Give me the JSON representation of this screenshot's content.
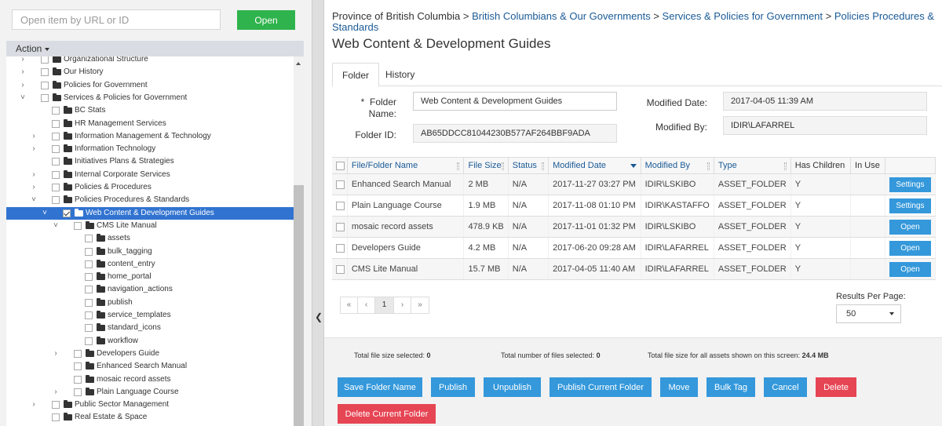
{
  "left": {
    "url_placeholder": "Open item by URL or ID",
    "open_label": "Open",
    "action_label": "Action"
  },
  "tree": [
    {
      "label": "Organizational Structure",
      "level": 0,
      "expander": "right",
      "checked": false,
      "selected": false
    },
    {
      "label": "Our History",
      "level": 0,
      "expander": "right",
      "checked": false,
      "selected": false
    },
    {
      "label": "Policies for Government",
      "level": 0,
      "expander": "right",
      "checked": false,
      "selected": false
    },
    {
      "label": "Services & Policies for Government",
      "level": 0,
      "expander": "down",
      "checked": false,
      "selected": false
    },
    {
      "label": "BC Stats",
      "level": 1,
      "expander": "none",
      "checked": false,
      "selected": false
    },
    {
      "label": "HR Management Services",
      "level": 1,
      "expander": "none",
      "checked": false,
      "selected": false
    },
    {
      "label": "Information Management & Technology",
      "level": 1,
      "expander": "right",
      "checked": false,
      "selected": false
    },
    {
      "label": "Information Technology",
      "level": 1,
      "expander": "right",
      "checked": false,
      "selected": false
    },
    {
      "label": "Initiatives Plans & Strategies",
      "level": 1,
      "expander": "none",
      "checked": false,
      "selected": false
    },
    {
      "label": "Internal Corporate Services",
      "level": 1,
      "expander": "right",
      "checked": false,
      "selected": false
    },
    {
      "label": "Policies & Procedures",
      "level": 1,
      "expander": "right",
      "checked": false,
      "selected": false
    },
    {
      "label": "Policies Procedures & Standards",
      "level": 1,
      "expander": "down",
      "checked": false,
      "selected": false
    },
    {
      "label": "Web Content & Development Guides",
      "level": 2,
      "expander": "down",
      "checked": true,
      "selected": true
    },
    {
      "label": "CMS Lite Manual",
      "level": 3,
      "expander": "down",
      "checked": false,
      "selected": false
    },
    {
      "label": "assets",
      "level": 4,
      "expander": "none",
      "checked": false,
      "selected": false
    },
    {
      "label": "bulk_tagging",
      "level": 4,
      "expander": "none",
      "checked": false,
      "selected": false
    },
    {
      "label": "content_entry",
      "level": 4,
      "expander": "none",
      "checked": false,
      "selected": false
    },
    {
      "label": "home_portal",
      "level": 4,
      "expander": "none",
      "checked": false,
      "selected": false
    },
    {
      "label": "navigation_actions",
      "level": 4,
      "expander": "none",
      "checked": false,
      "selected": false
    },
    {
      "label": "publish",
      "level": 4,
      "expander": "none",
      "checked": false,
      "selected": false
    },
    {
      "label": "service_templates",
      "level": 4,
      "expander": "none",
      "checked": false,
      "selected": false
    },
    {
      "label": "standard_icons",
      "level": 4,
      "expander": "none",
      "checked": false,
      "selected": false
    },
    {
      "label": "workflow",
      "level": 4,
      "expander": "none",
      "checked": false,
      "selected": false
    },
    {
      "label": "Developers Guide",
      "level": 3,
      "expander": "right",
      "checked": false,
      "selected": false
    },
    {
      "label": "Enhanced Search Manual",
      "level": 3,
      "expander": "none",
      "checked": false,
      "selected": false
    },
    {
      "label": "mosaic record assets",
      "level": 3,
      "expander": "none",
      "checked": false,
      "selected": false
    },
    {
      "label": "Plain Language Course",
      "level": 3,
      "expander": "right",
      "checked": false,
      "selected": false
    },
    {
      "label": "Public Sector Management",
      "level": 1,
      "expander": "right",
      "checked": false,
      "selected": false
    },
    {
      "label": "Real Estate & Space",
      "level": 1,
      "expander": "none",
      "checked": false,
      "selected": false
    }
  ],
  "breadcrumb": {
    "root": "Province of British Columbia",
    "sep": " > ",
    "links": [
      "British Columbians & Our Governments",
      "Services & Policies for Government",
      "Policies Procedures & Standards"
    ]
  },
  "page_title": "Web Content & Development Guides",
  "tabs": [
    {
      "label": "Folder",
      "active": true
    },
    {
      "label": "History",
      "active": false
    }
  ],
  "form": {
    "required_mark": "*",
    "folder_name_label": "Folder",
    "folder_name_label2": "Name:",
    "folder_name_value": "Web Content & Development Guides",
    "folder_id_label": "Folder ID:",
    "folder_id_value": "AB65DDCC81044230B577AF264BBF9ADA",
    "modified_date_label": "Modified Date:",
    "modified_date_value": "2017-04-05 11:39 AM",
    "modified_by_label": "Modified By:",
    "modified_by_value": "IDIR\\LAFARREL"
  },
  "table": {
    "columns": [
      "File/Folder Name",
      "File Size",
      "Status",
      "Modified Date",
      "Modified By",
      "Type",
      "Has Children",
      "In Use"
    ],
    "rows": [
      {
        "name": "Enhanced Search Manual",
        "size": "2 MB",
        "status": "N/A",
        "date": "2017-11-27 03:27 PM",
        "by": "IDIR\\LSKIBO",
        "type": "ASSET_FOLDER",
        "children": "Y",
        "inuse": "",
        "action": "Settings"
      },
      {
        "name": "Plain Language Course",
        "size": "1.9 MB",
        "status": "N/A",
        "date": "2017-11-08 01:10 PM",
        "by": "IDIR\\KASTAFFO",
        "type": "ASSET_FOLDER",
        "children": "Y",
        "inuse": "",
        "action": "Settings"
      },
      {
        "name": "mosaic record assets",
        "size": "478.9 KB",
        "status": "N/A",
        "date": "2017-11-01 01:32 PM",
        "by": "IDIR\\LSKIBO",
        "type": "ASSET_FOLDER",
        "children": "Y",
        "inuse": "",
        "action": "Open"
      },
      {
        "name": "Developers Guide",
        "size": "4.2 MB",
        "status": "N/A",
        "date": "2017-06-20 09:28 AM",
        "by": "IDIR\\LAFARREL",
        "type": "ASSET_FOLDER",
        "children": "Y",
        "inuse": "",
        "action": "Open"
      },
      {
        "name": "CMS Lite Manual",
        "size": "15.7 MB",
        "status": "N/A",
        "date": "2017-04-05 11:40 AM",
        "by": "IDIR\\LAFARREL",
        "type": "ASSET_FOLDER",
        "children": "Y",
        "inuse": "",
        "action": "Open"
      }
    ]
  },
  "pager": {
    "first": "«",
    "prev": "‹",
    "current": "1",
    "next": "›",
    "last": "»"
  },
  "rpp": {
    "label": "Results Per Page:",
    "value": "50"
  },
  "totals": {
    "selected_size_label": "Total file size selected: ",
    "selected_size_value": "0",
    "selected_count_label": "Total number of files selected: ",
    "selected_count_value": "0",
    "screen_size_label": "Total file size for all assets shown on this screen: ",
    "screen_size_value": "24.4 MB"
  },
  "buttons": {
    "save_folder_name": "Save Folder Name",
    "publish": "Publish",
    "unpublish": "Unpublish",
    "publish_current": "Publish Current Folder",
    "move": "Move",
    "bulk_tag": "Bulk Tag",
    "cancel": "Cancel",
    "delete": "Delete",
    "delete_current": "Delete Current Folder"
  },
  "colors": {
    "accent": "#3498db",
    "success": "#2fb34c",
    "danger": "#e64553",
    "link": "#1a5a96",
    "selected": "#3173d0"
  }
}
